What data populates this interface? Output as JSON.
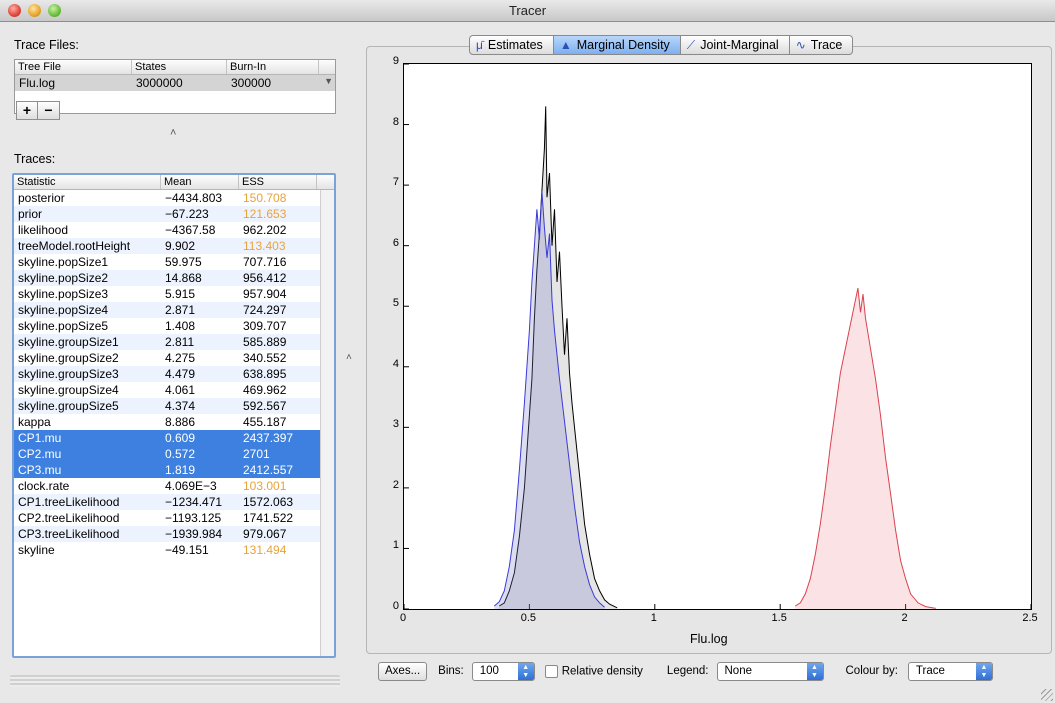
{
  "window": {
    "title": "Tracer"
  },
  "trace_files": {
    "label": "Trace Files:",
    "columns": [
      "Tree File",
      "States",
      "Burn-In"
    ],
    "rows": [
      {
        "file": "Flu.log",
        "states": "3000000",
        "burnin": "300000"
      }
    ],
    "add_label": "+",
    "remove_label": "−"
  },
  "traces": {
    "label": "Traces:",
    "columns": [
      "Statistic",
      "Mean",
      "ESS"
    ],
    "rows": [
      {
        "stat": "posterior",
        "mean": "−4434.803",
        "ess": "150.708",
        "low": true
      },
      {
        "stat": "prior",
        "mean": "−67.223",
        "ess": "121.653",
        "low": true
      },
      {
        "stat": "likelihood",
        "mean": "−4367.58",
        "ess": "962.202",
        "low": false
      },
      {
        "stat": "treeModel.rootHeight",
        "mean": "9.902",
        "ess": "113.403",
        "low": true
      },
      {
        "stat": "skyline.popSize1",
        "mean": "59.975",
        "ess": "707.716",
        "low": false
      },
      {
        "stat": "skyline.popSize2",
        "mean": "14.868",
        "ess": "956.412",
        "low": false
      },
      {
        "stat": "skyline.popSize3",
        "mean": "5.915",
        "ess": "957.904",
        "low": false
      },
      {
        "stat": "skyline.popSize4",
        "mean": "2.871",
        "ess": "724.297",
        "low": false
      },
      {
        "stat": "skyline.popSize5",
        "mean": "1.408",
        "ess": "309.707",
        "low": false
      },
      {
        "stat": "skyline.groupSize1",
        "mean": "2.811",
        "ess": "585.889",
        "low": false
      },
      {
        "stat": "skyline.groupSize2",
        "mean": "4.275",
        "ess": "340.552",
        "low": false
      },
      {
        "stat": "skyline.groupSize3",
        "mean": "4.479",
        "ess": "638.895",
        "low": false
      },
      {
        "stat": "skyline.groupSize4",
        "mean": "4.061",
        "ess": "469.962",
        "low": false
      },
      {
        "stat": "skyline.groupSize5",
        "mean": "4.374",
        "ess": "592.567",
        "low": false
      },
      {
        "stat": "kappa",
        "mean": "8.886",
        "ess": "455.187",
        "low": false
      },
      {
        "stat": "CP1.mu",
        "mean": "0.609",
        "ess": "2437.397",
        "low": false,
        "selected": true
      },
      {
        "stat": "CP2.mu",
        "mean": "0.572",
        "ess": "2701",
        "low": false,
        "selected": true
      },
      {
        "stat": "CP3.mu",
        "mean": "1.819",
        "ess": "2412.557",
        "low": false,
        "selected": true
      },
      {
        "stat": "clock.rate",
        "mean": "4.069E−3",
        "ess": "103.001",
        "low": true
      },
      {
        "stat": "CP1.treeLikelihood",
        "mean": "−1234.471",
        "ess": "1572.063",
        "low": false
      },
      {
        "stat": "CP2.treeLikelihood",
        "mean": "−1193.125",
        "ess": "1741.522",
        "low": false
      },
      {
        "stat": "CP3.treeLikelihood",
        "mean": "−1939.984",
        "ess": "979.067",
        "low": false
      },
      {
        "stat": "skyline",
        "mean": "−49.151",
        "ess": "131.494",
        "low": true
      }
    ]
  },
  "tabs": [
    {
      "label": "Estimates",
      "icon": "mu-icon",
      "glyph": "μ̄",
      "active": false
    },
    {
      "label": "Marginal Density",
      "icon": "density-icon",
      "glyph": "▲",
      "active": true
    },
    {
      "label": "Joint-Marginal",
      "icon": "scatter-icon",
      "glyph": "⟋",
      "active": false
    },
    {
      "label": "Trace",
      "icon": "trace-icon",
      "glyph": "∿",
      "active": false
    }
  ],
  "controls": {
    "axes_label": "Axes...",
    "bins_label": "Bins:",
    "bins_value": "100",
    "relative_density_label": "Relative density",
    "relative_density_checked": false,
    "legend_label": "Legend:",
    "legend_value": "None",
    "colour_by_label": "Colour by:",
    "colour_by_value": "Trace"
  },
  "chart_data": {
    "type": "area",
    "xlabel": "Flu.log",
    "xlim": [
      0,
      2.5
    ],
    "ylim": [
      0,
      9
    ],
    "xticks": [
      "0",
      "0.5",
      "1",
      "1.5",
      "2",
      "2.5"
    ],
    "yticks": [
      "0",
      "1",
      "2",
      "3",
      "4",
      "5",
      "6",
      "7",
      "8",
      "9"
    ],
    "series": [
      {
        "color": "#000000",
        "fill": "rgba(150,150,150,0.25)",
        "x": [
          0.38,
          0.4,
          0.42,
          0.44,
          0.46,
          0.48,
          0.5,
          0.51,
          0.52,
          0.53,
          0.54,
          0.55,
          0.56,
          0.565,
          0.57,
          0.58,
          0.59,
          0.6,
          0.61,
          0.62,
          0.63,
          0.64,
          0.65,
          0.66,
          0.67,
          0.68,
          0.7,
          0.72,
          0.74,
          0.76,
          0.78,
          0.8,
          0.82,
          0.85
        ],
        "y": [
          0.05,
          0.1,
          0.3,
          0.6,
          1.2,
          2.0,
          3.2,
          3.8,
          4.8,
          5.6,
          6.2,
          6.9,
          7.6,
          8.3,
          6.8,
          7.2,
          6.0,
          6.6,
          5.4,
          5.9,
          5.0,
          4.2,
          4.8,
          3.9,
          3.4,
          3.0,
          2.2,
          1.4,
          0.9,
          0.5,
          0.3,
          0.15,
          0.08,
          0.02
        ]
      },
      {
        "color": "#3a3ad6",
        "fill": "rgba(120,120,200,0.25)",
        "x": [
          0.36,
          0.38,
          0.4,
          0.42,
          0.44,
          0.46,
          0.48,
          0.5,
          0.51,
          0.52,
          0.53,
          0.54,
          0.55,
          0.56,
          0.57,
          0.58,
          0.59,
          0.6,
          0.62,
          0.64,
          0.66,
          0.68,
          0.7,
          0.72,
          0.74,
          0.76,
          0.78,
          0.8
        ],
        "y": [
          0.05,
          0.12,
          0.3,
          0.7,
          1.3,
          2.3,
          3.4,
          4.6,
          5.4,
          6.0,
          6.6,
          6.1,
          6.9,
          6.3,
          5.8,
          6.2,
          5.1,
          4.6,
          3.8,
          3.1,
          2.4,
          1.7,
          1.1,
          0.7,
          0.4,
          0.2,
          0.1,
          0.03
        ]
      },
      {
        "color": "#d9424e",
        "fill": "rgba(240,140,150,0.25)",
        "x": [
          1.56,
          1.58,
          1.6,
          1.62,
          1.64,
          1.66,
          1.68,
          1.7,
          1.72,
          1.74,
          1.76,
          1.78,
          1.79,
          1.8,
          1.81,
          1.82,
          1.83,
          1.84,
          1.86,
          1.88,
          1.9,
          1.92,
          1.94,
          1.96,
          1.98,
          2.0,
          2.02,
          2.05,
          2.08,
          2.12
        ],
        "y": [
          0.05,
          0.1,
          0.25,
          0.5,
          0.9,
          1.4,
          2.0,
          2.7,
          3.3,
          3.9,
          4.3,
          4.7,
          4.9,
          5.1,
          5.3,
          4.9,
          5.2,
          4.8,
          4.3,
          3.8,
          3.2,
          2.5,
          1.9,
          1.3,
          0.8,
          0.5,
          0.25,
          0.1,
          0.04,
          0.01
        ]
      }
    ]
  }
}
